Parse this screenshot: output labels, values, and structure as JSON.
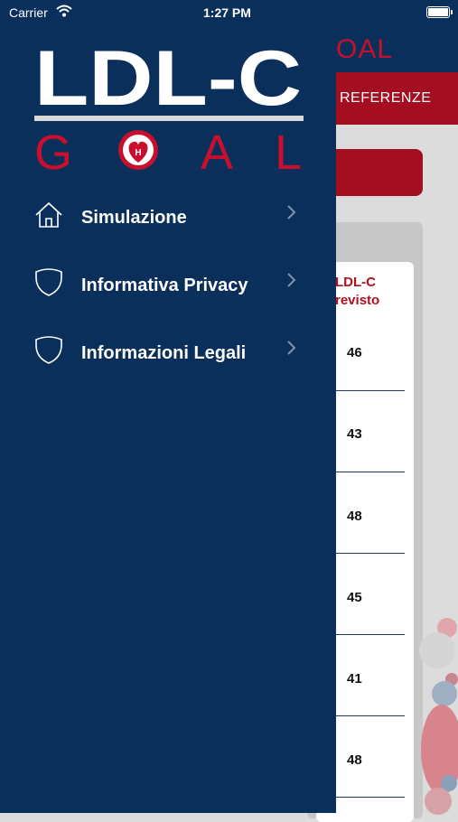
{
  "status_bar": {
    "carrier": "Carrier",
    "time": "1:27 PM"
  },
  "background": {
    "title_fragment": "OAL",
    "tab_fragment": "REFERENZE",
    "column_title_line1": "LDL-C",
    "column_title_line2": "revisto",
    "rows": [
      "46",
      "43",
      "48",
      "45",
      "41",
      "48"
    ]
  },
  "drawer": {
    "logo_line1": "LDL-C",
    "logo_line2_left": "G",
    "logo_line2_right": "A L",
    "menu": [
      {
        "label": "Simulazione",
        "icon": "home-icon"
      },
      {
        "label": "Informativa Privacy",
        "icon": "shield-icon"
      },
      {
        "label": "Informazioni Legali",
        "icon": "shield-icon"
      }
    ]
  },
  "colors": {
    "navy": "#0b2f5b",
    "red": "#c8102e",
    "dark_red": "#a30f20",
    "white": "#ffffff"
  }
}
